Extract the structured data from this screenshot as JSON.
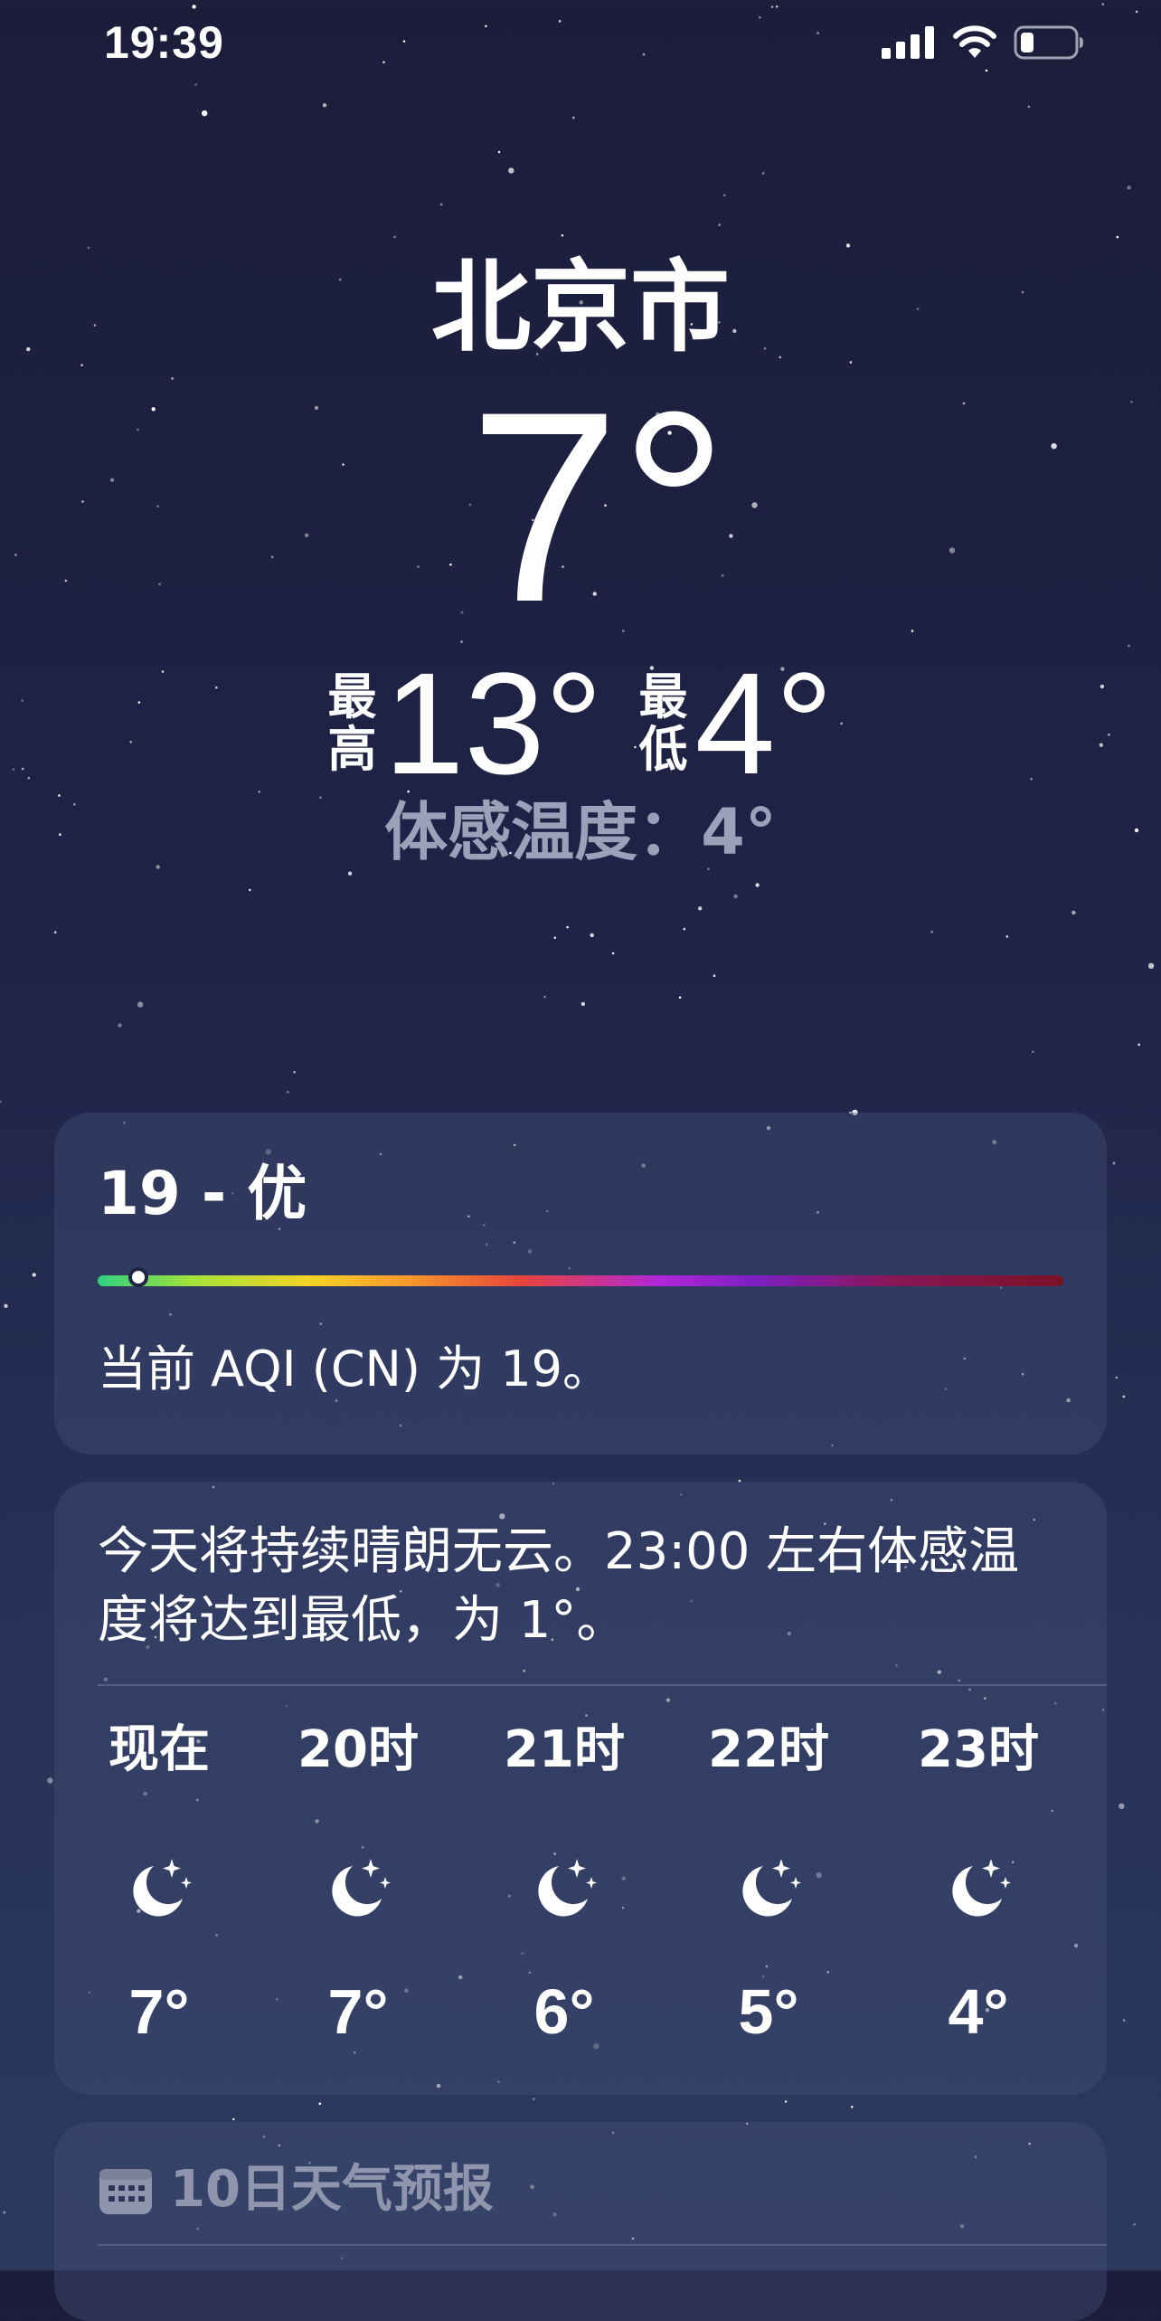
{
  "status_bar": {
    "time": "19:39",
    "icons": [
      "cellular-signal-icon",
      "wifi-icon",
      "battery-icon"
    ]
  },
  "hero": {
    "city": "北京市",
    "temperature": "7°",
    "high_label": "最高",
    "high_value": "13°",
    "low_label": "最低",
    "low_value": "4°",
    "feels_like": "体感温度：4°"
  },
  "aqi": {
    "title": "19 - 优",
    "level_fraction": 0.04,
    "description": "当前 AQI (CN) 为 19。"
  },
  "hourly": {
    "summary": "今天将持续晴朗无云。23:00 左右体感温度将达到最低，为 1°。",
    "items": [
      {
        "label": "现在",
        "icon": "moon-stars-icon",
        "temp": "7°"
      },
      {
        "label": "20时",
        "icon": "moon-stars-icon",
        "temp": "7°"
      },
      {
        "label": "21时",
        "icon": "moon-stars-icon",
        "temp": "6°"
      },
      {
        "label": "22时",
        "icon": "moon-stars-icon",
        "temp": "5°"
      },
      {
        "label": "23时",
        "icon": "moon-stars-icon",
        "temp": "4°"
      }
    ]
  },
  "forecast": {
    "icon": "calendar-icon",
    "title": "10日天气预报"
  },
  "colors": {
    "background_top": "#1c1d3a",
    "background_bottom": "#2b3a5e",
    "secondary_text": "#9ba1b8",
    "aqi_good": "#2fd17d"
  }
}
